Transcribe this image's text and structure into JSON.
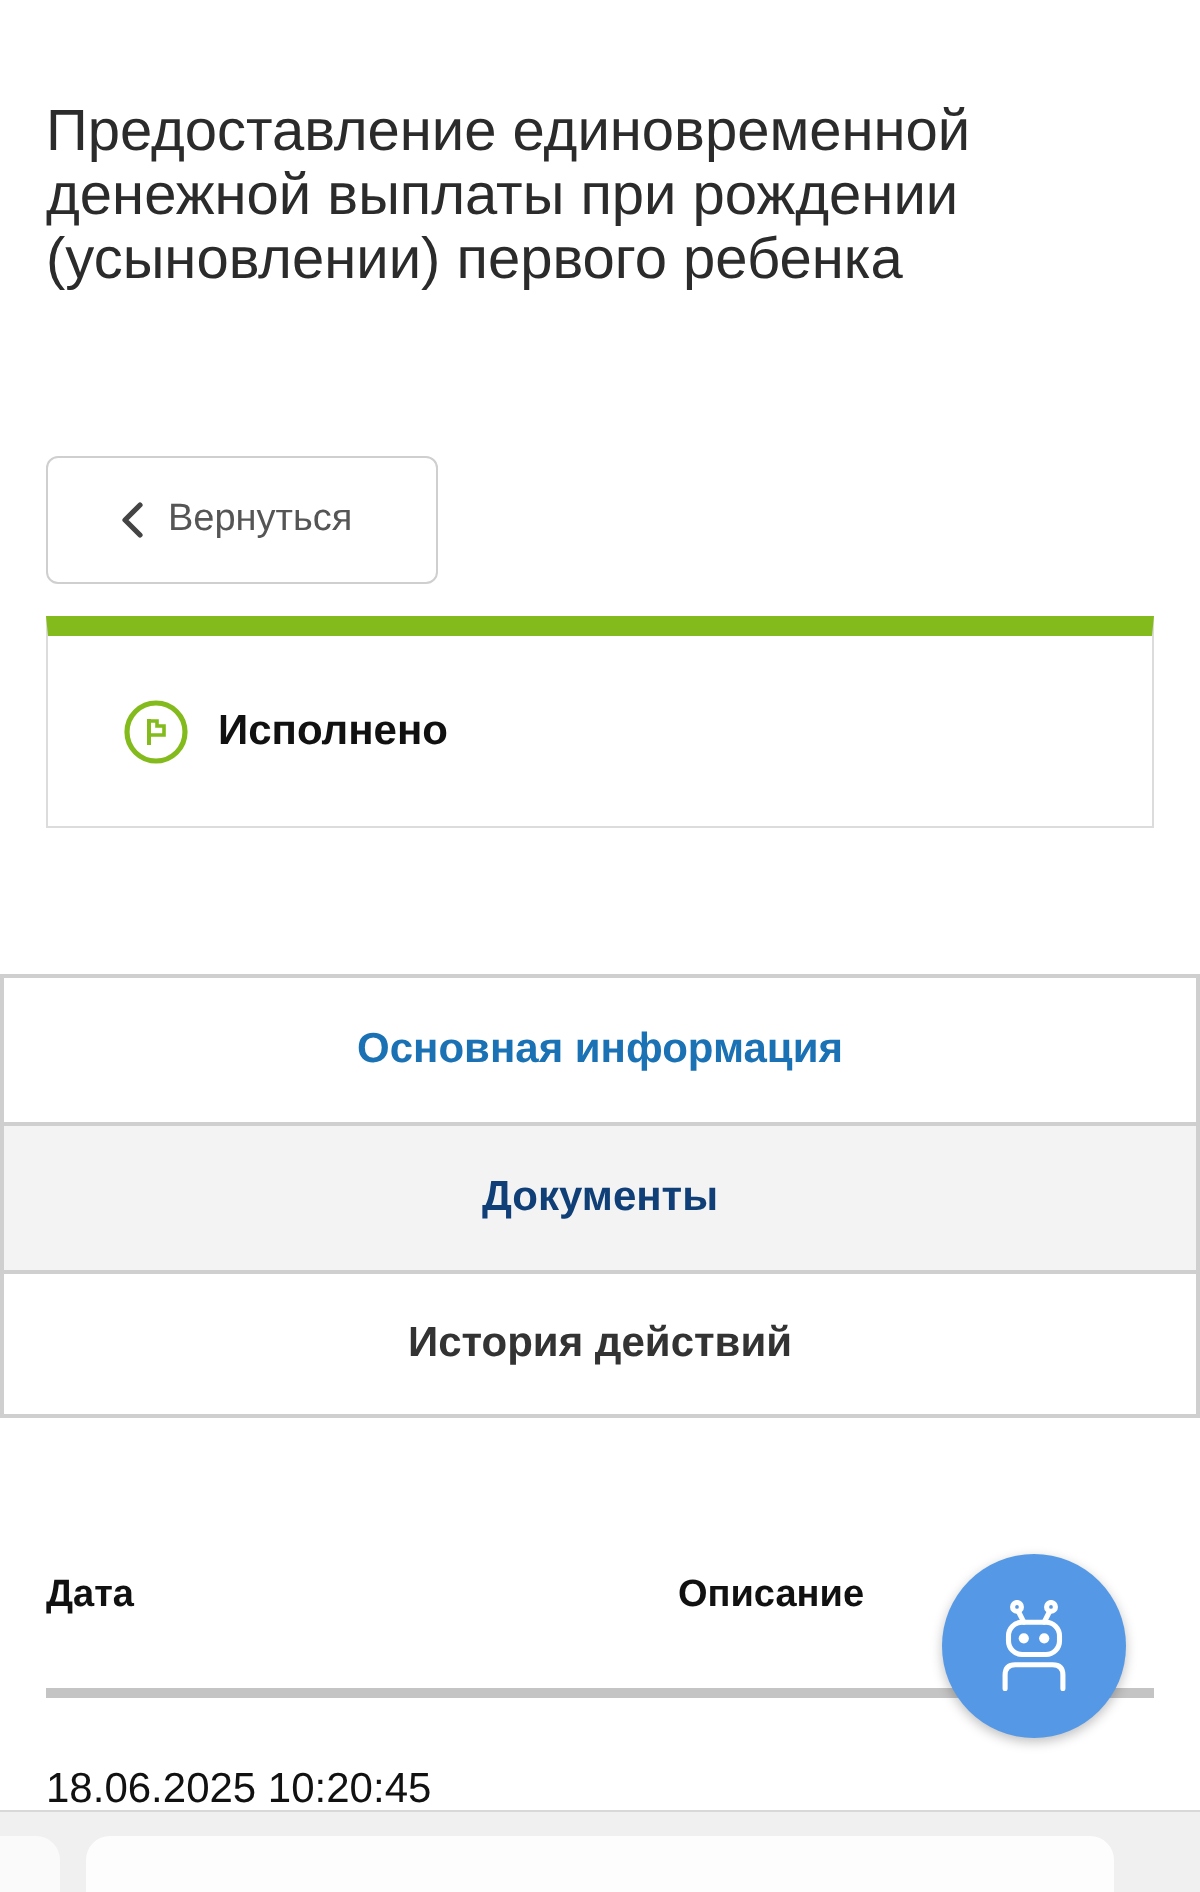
{
  "page": {
    "title": "Предоставление единовременной денежной выплаты при рождении (усыновлении) первого ребенка"
  },
  "back_button": {
    "label": "Вернуться"
  },
  "status": {
    "label": "Исполнено"
  },
  "tabs": [
    {
      "label": "Основная информация",
      "selected": false,
      "color": "#1a72b5"
    },
    {
      "label": "Документы",
      "selected": true,
      "color": "#103f78"
    },
    {
      "label": "История действий",
      "selected": false,
      "color": "#333333"
    }
  ],
  "table": {
    "columns": [
      "Дата",
      "Описание"
    ],
    "rows": [
      [
        "18.06.2025 10:20:45"
      ]
    ]
  }
}
